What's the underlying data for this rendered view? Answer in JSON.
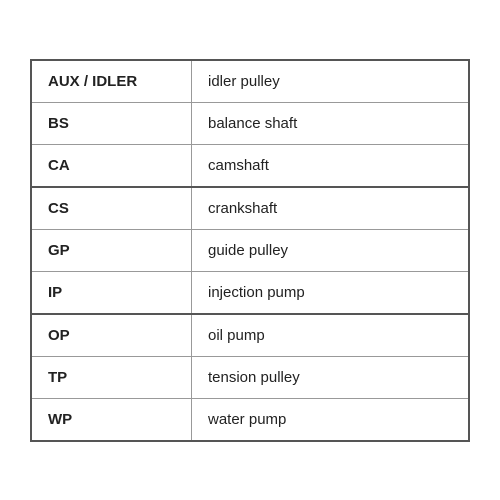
{
  "table": {
    "rows": [
      {
        "abbr": "AUX / IDLER",
        "desc": "idler pulley",
        "thickBottom": false
      },
      {
        "abbr": "BS",
        "desc": "balance shaft",
        "thickBottom": false
      },
      {
        "abbr": "CA",
        "desc": "camshaft",
        "thickBottom": true
      },
      {
        "abbr": "CS",
        "desc": "crankshaft",
        "thickBottom": false
      },
      {
        "abbr": "GP",
        "desc": "guide pulley",
        "thickBottom": false
      },
      {
        "abbr": "IP",
        "desc": "injection pump",
        "thickBottom": true
      },
      {
        "abbr": "OP",
        "desc": "oil pump",
        "thickBottom": false
      },
      {
        "abbr": "TP",
        "desc": "tension pulley",
        "thickBottom": false
      },
      {
        "abbr": "WP",
        "desc": "water pump",
        "thickBottom": false
      }
    ]
  }
}
